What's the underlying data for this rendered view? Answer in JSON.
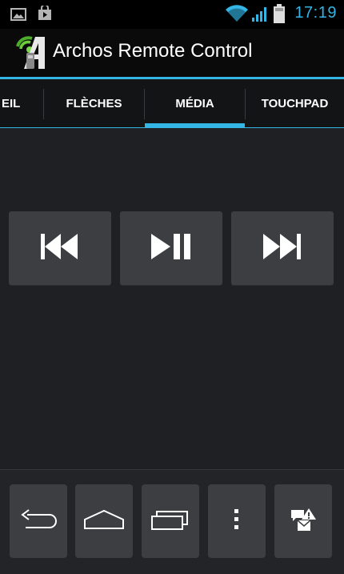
{
  "status_bar": {
    "time": "17:19",
    "icons": [
      "gallery-icon",
      "play-store-icon",
      "wifi-icon",
      "signal-icon",
      "battery-icon"
    ],
    "accent_color": "#33b5e5"
  },
  "action_bar": {
    "title": "Archos Remote Control",
    "logo_icon": "archos-remote-logo"
  },
  "tabs": [
    {
      "label": "EIL",
      "selected": false
    },
    {
      "label": "FLÈCHES",
      "selected": false
    },
    {
      "label": "MÉDIA",
      "selected": true
    },
    {
      "label": "TOUCHPAD",
      "selected": false
    }
  ],
  "media_controls": [
    {
      "icon": "previous-track-icon"
    },
    {
      "icon": "play-pause-icon"
    },
    {
      "icon": "next-track-icon"
    }
  ],
  "nav_buttons": [
    {
      "icon": "back-icon"
    },
    {
      "icon": "home-icon"
    },
    {
      "icon": "recent-apps-icon"
    },
    {
      "icon": "overflow-menu-icon"
    },
    {
      "icon": "notifications-icon"
    }
  ]
}
